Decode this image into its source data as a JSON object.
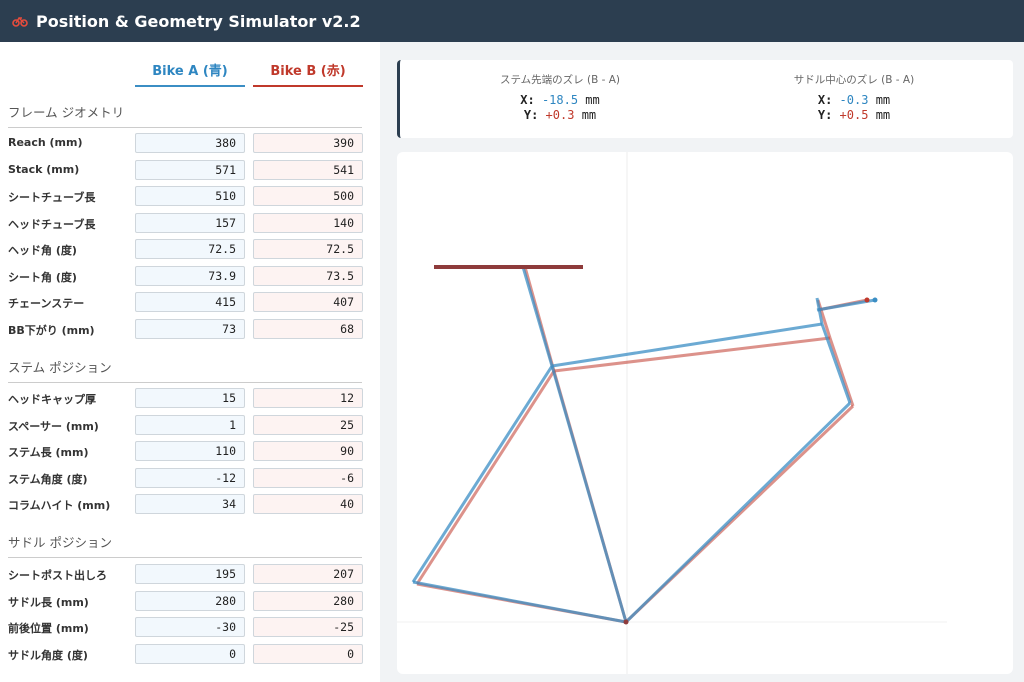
{
  "header": {
    "title": "Position & Geometry Simulator v2.2",
    "logo_icon": "bicycle-icon"
  },
  "columns": {
    "a_label": "Bike A (青)",
    "b_label": "Bike B (赤)"
  },
  "sections": {
    "frame": "フレーム ジオメトリ",
    "stem": "ステム ポジション",
    "saddle": "サドル ポジション"
  },
  "frame_rows": [
    {
      "label": "Reach (mm)",
      "a": "380",
      "b": "390"
    },
    {
      "label": "Stack (mm)",
      "a": "571",
      "b": "541"
    },
    {
      "label": "シートチューブ長",
      "a": "510",
      "b": "500"
    },
    {
      "label": "ヘッドチューブ長",
      "a": "157",
      "b": "140"
    },
    {
      "label": "ヘッド角 (度)",
      "a": "72.5",
      "b": "72.5"
    },
    {
      "label": "シート角 (度)",
      "a": "73.9",
      "b": "73.5"
    },
    {
      "label": "チェーンステー",
      "a": "415",
      "b": "407"
    },
    {
      "label": "BB下がり (mm)",
      "a": "73",
      "b": "68"
    }
  ],
  "stem_rows": [
    {
      "label": "ヘッドキャップ厚",
      "a": "15",
      "b": "12"
    },
    {
      "label": "スペーサー (mm)",
      "a": "1",
      "b": "25"
    },
    {
      "label": "ステム長 (mm)",
      "a": "110",
      "b": "90"
    },
    {
      "label": "ステム角度 (度)",
      "a": "-12",
      "b": "-6"
    },
    {
      "label": "コラムハイト (mm)",
      "a": "34",
      "b": "40"
    }
  ],
  "saddle_rows": [
    {
      "label": "シートポスト出しろ",
      "a": "195",
      "b": "207"
    },
    {
      "label": "サドル長 (mm)",
      "a": "280",
      "b": "280"
    },
    {
      "label": "前後位置 (mm)",
      "a": "-30",
      "b": "-25"
    },
    {
      "label": "サドル角度 (度)",
      "a": "0",
      "b": "0"
    }
  ],
  "diff": {
    "stem": {
      "label": "ステム先端のズレ (B - A)",
      "x_axis": "X:",
      "x_value": "-18.5",
      "y_axis": "Y:",
      "y_value": "+0.3",
      "unit": "mm"
    },
    "saddle": {
      "label": "サドル中心のズレ (B - A)",
      "x_axis": "X:",
      "x_value": "-0.3",
      "y_axis": "Y:",
      "y_value": "+0.5",
      "unit": "mm"
    }
  },
  "colors": {
    "bike_a": "#3b8ec4",
    "bike_b": "#c0392b",
    "header_bg": "#2c3e50"
  }
}
